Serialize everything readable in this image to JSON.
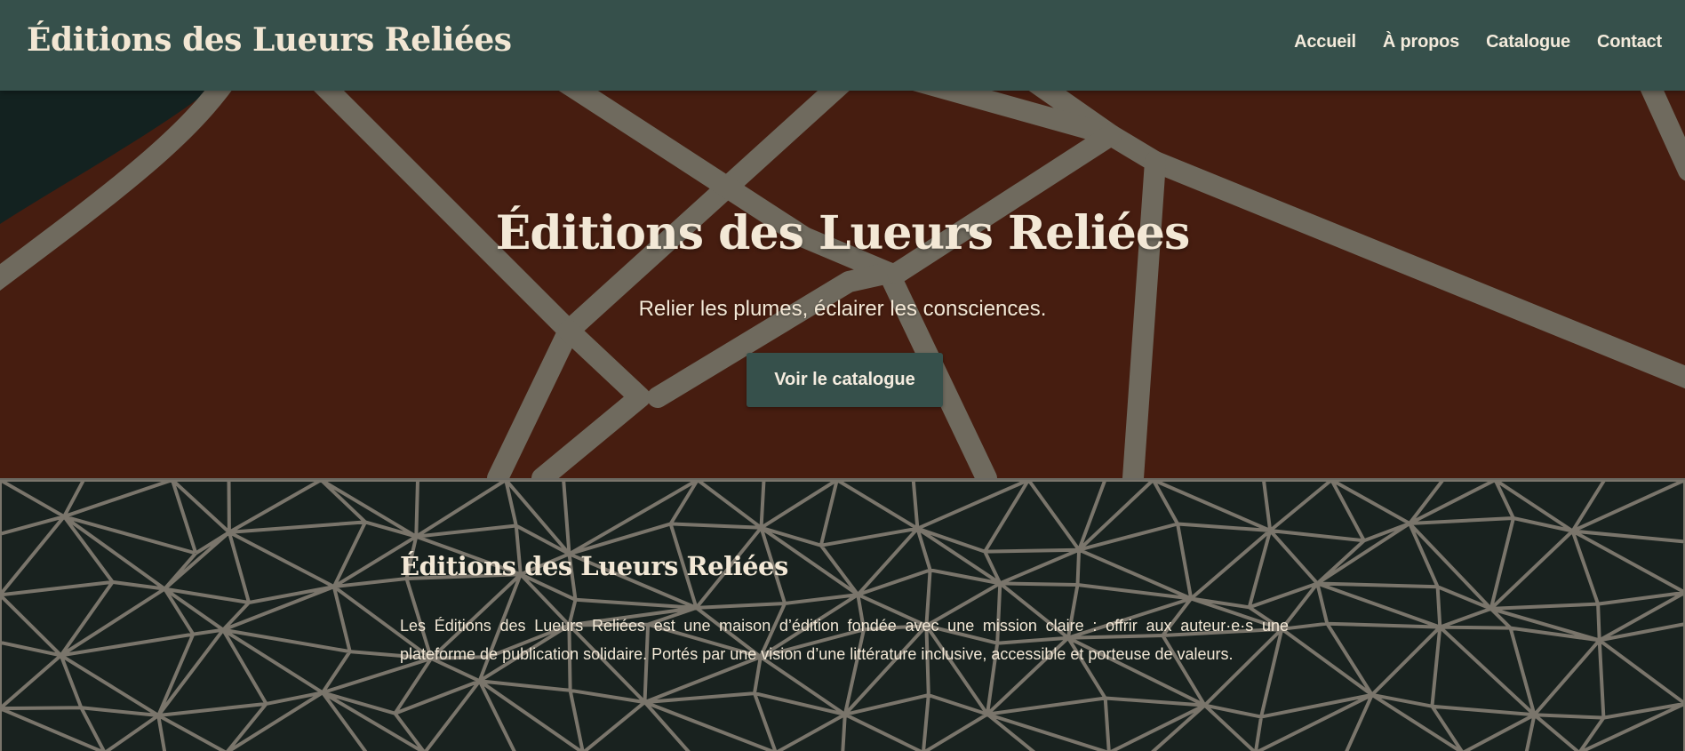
{
  "header": {
    "brand": "Éditions des Lueurs Reliées",
    "nav": [
      {
        "label": "Accueil"
      },
      {
        "label": "À propos"
      },
      {
        "label": "Catalogue"
      },
      {
        "label": "Contact"
      }
    ]
  },
  "hero": {
    "title": "Éditions des Lueurs Reliées",
    "tagline": "Relier les plumes, éclairer les consciences.",
    "cta_label": "Voir le catalogue"
  },
  "about": {
    "title": "Éditions des Lueurs Reliées",
    "text": "Les Éditions des Lueurs Reliées est une maison d’édition fondée avec une mission claire : offrir aux auteur·e·s une plateforme de publication solidaire. Portés par une vision d’une littérature inclusive, accessible et porteuse de valeurs."
  },
  "colors": {
    "header_bg": "#36504b",
    "hero_bg": "#461d10",
    "about_bg": "#19221f",
    "pattern_lines": "#6e6b62",
    "text_cream": "#f3e8d6"
  }
}
